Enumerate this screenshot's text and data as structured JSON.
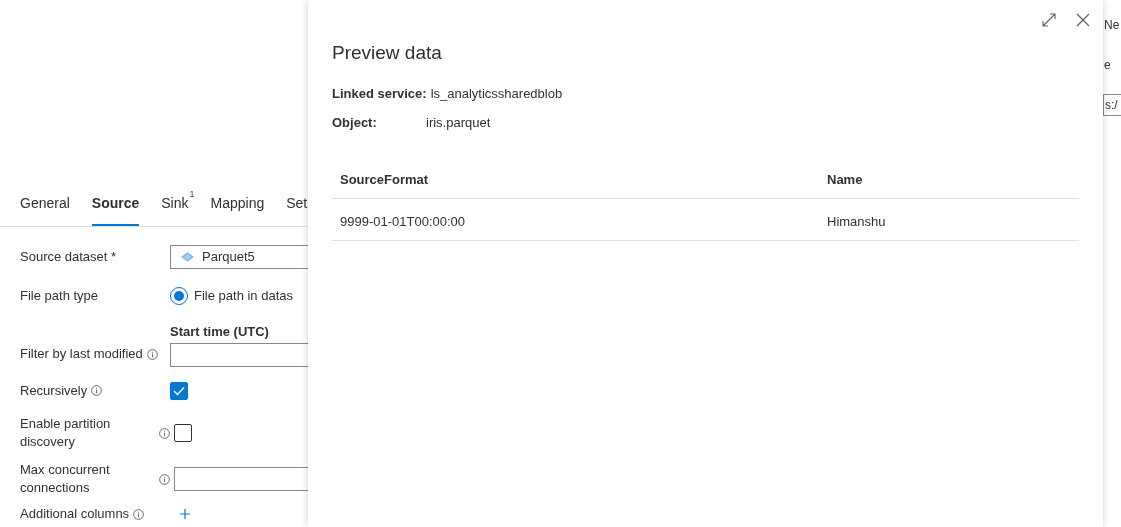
{
  "activity_tabs": [
    {
      "label": "General",
      "selected": false
    },
    {
      "label": "Source",
      "selected": true
    },
    {
      "label": "Sink",
      "selected": false,
      "badge": "1"
    },
    {
      "label": "Mapping",
      "selected": false
    },
    {
      "label": "Set",
      "selected": false
    }
  ],
  "source_form": [
    {
      "kind": "dropdown",
      "label": "Source dataset *",
      "value": "Parquet5"
    },
    {
      "kind": "radio",
      "label": "File path type",
      "option": "File path in datas",
      "selected": true
    },
    {
      "kind": "datetime",
      "label": "Filter by last modified",
      "info": true,
      "field_label": "Start time (UTC)"
    },
    {
      "kind": "checkbox",
      "label": "Recursively",
      "info": true,
      "checked": true
    },
    {
      "kind": "checkbox",
      "label": "Enable partition discovery",
      "info": true,
      "checked": false,
      "wide": true
    },
    {
      "kind": "number",
      "label": "Max concurrent connections",
      "info": true
    },
    {
      "kind": "add",
      "label": "Additional columns",
      "info": true
    }
  ],
  "right_panel_fragments": [
    {
      "text": "Ne",
      "kind": "text"
    },
    {
      "text": "e",
      "kind": "text"
    },
    {
      "text": "s:/",
      "kind": "field"
    }
  ],
  "preview_panel": {
    "title": "Preview data",
    "fields": [
      {
        "label": "Linked service:",
        "value": "ls_analyticssharedblob"
      },
      {
        "label": "Object:",
        "value": "iris.parquet"
      }
    ],
    "table": {
      "columns": [
        "SourceFormat",
        "Name"
      ],
      "rows": [
        [
          "9999-01-01T00:00:00",
          "Himanshu"
        ]
      ]
    }
  }
}
